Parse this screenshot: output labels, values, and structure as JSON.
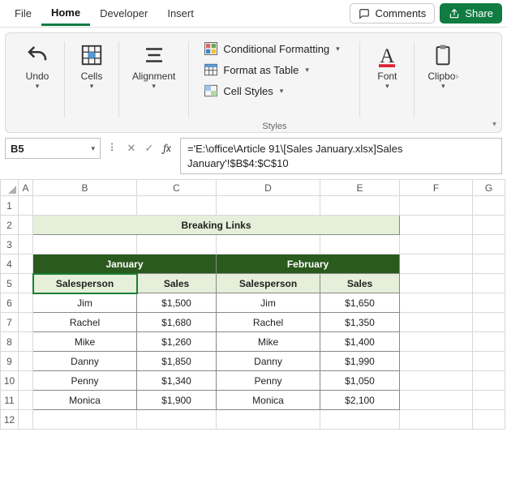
{
  "menu": {
    "tabs": [
      "File",
      "Home",
      "Developer",
      "Insert"
    ],
    "active": "Home",
    "comments": "Comments",
    "share": "Share"
  },
  "ribbon": {
    "undo": "Undo",
    "cells": "Cells",
    "alignment": "Alignment",
    "styles_caption": "Styles",
    "cond_fmt": "Conditional Formatting",
    "fmt_table": "Format as Table",
    "cell_styles": "Cell Styles",
    "font": "Font",
    "clipboard": "Clipbo"
  },
  "namebox": "B5",
  "formula": "='E:\\office\\Article 91\\[Sales January.xlsx]Sales January'!$B$4:$C$10",
  "columns": [
    "A",
    "B",
    "C",
    "D",
    "E",
    "F",
    "G"
  ],
  "rows": [
    "1",
    "2",
    "3",
    "4",
    "5",
    "6",
    "7",
    "8",
    "9",
    "10",
    "11",
    "12"
  ],
  "content": {
    "title": "Breaking Links",
    "months": {
      "jan": "January",
      "feb": "February"
    },
    "headers": {
      "salesperson": "Salesperson",
      "sales": "Sales"
    },
    "data": [
      {
        "name": "Jim",
        "jan": "$1,500",
        "feb": "$1,650"
      },
      {
        "name": "Rachel",
        "jan": "$1,680",
        "feb": "$1,350"
      },
      {
        "name": "Mike",
        "jan": "$1,260",
        "feb": "$1,400"
      },
      {
        "name": "Danny",
        "jan": "$1,850",
        "feb": "$1,990"
      },
      {
        "name": "Penny",
        "jan": "$1,340",
        "feb": "$1,050"
      },
      {
        "name": "Monica",
        "jan": "$1,900",
        "feb": "$2,100"
      }
    ]
  },
  "chart_data": {
    "type": "table",
    "title": "Breaking Links",
    "series": [
      {
        "name": "January",
        "values": [
          1500,
          1680,
          1260,
          1850,
          1340,
          1900
        ]
      },
      {
        "name": "February",
        "values": [
          1650,
          1350,
          1400,
          1990,
          1050,
          2100
        ]
      }
    ],
    "categories": [
      "Jim",
      "Rachel",
      "Mike",
      "Danny",
      "Penny",
      "Monica"
    ]
  }
}
